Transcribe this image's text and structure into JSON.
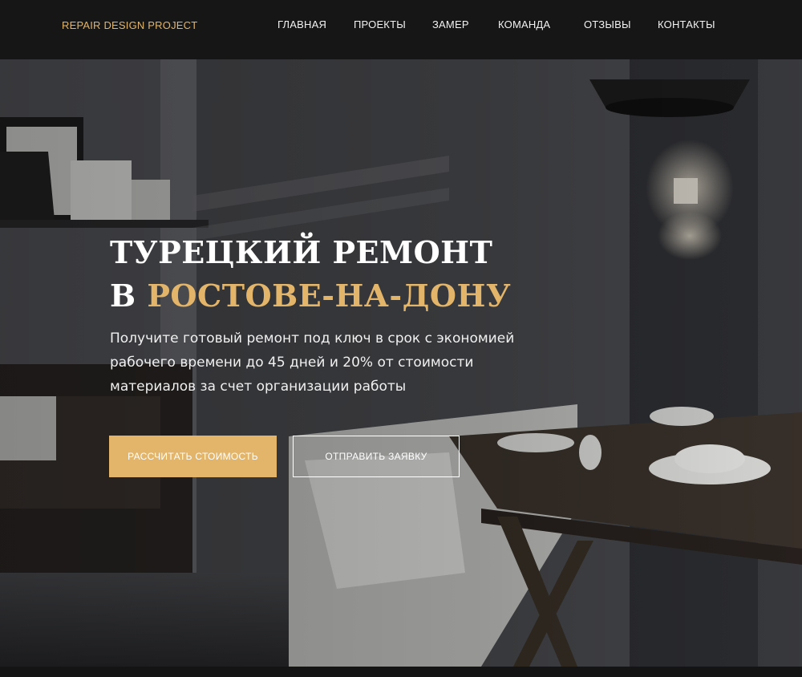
{
  "header": {
    "logo": "REPAIR DESIGN PROJECT",
    "nav": [
      {
        "label": "ГЛАВНАЯ"
      },
      {
        "label": "ПРОЕКТЫ"
      },
      {
        "label": "ЗАМЕР"
      },
      {
        "label": "КОМАНДА"
      },
      {
        "label": "ОТЗЫВЫ"
      },
      {
        "label": "КОНТАКТЫ"
      }
    ]
  },
  "hero": {
    "title_line1": "ТУРЕЦКИЙ РЕМОНТ",
    "title_line2_prefix": "В ",
    "title_line2_accent": "РОСТОВЕ-НА-ДОНУ",
    "subtitle": "Получите готовый ремонт под ключ в срок с экономией рабочего времени до 45 дней и 20% от стоимости материалов за счет организации работы",
    "primary_button": "РАССЧИТАТЬ СТОИМОСТЬ",
    "secondary_button": "ОТПРАВИТЬ ЗАЯВКУ",
    "background_image": "interior-photo"
  },
  "colors": {
    "accent": "#e2b56b",
    "header_bg": "#161616",
    "text": "#ffffff"
  }
}
